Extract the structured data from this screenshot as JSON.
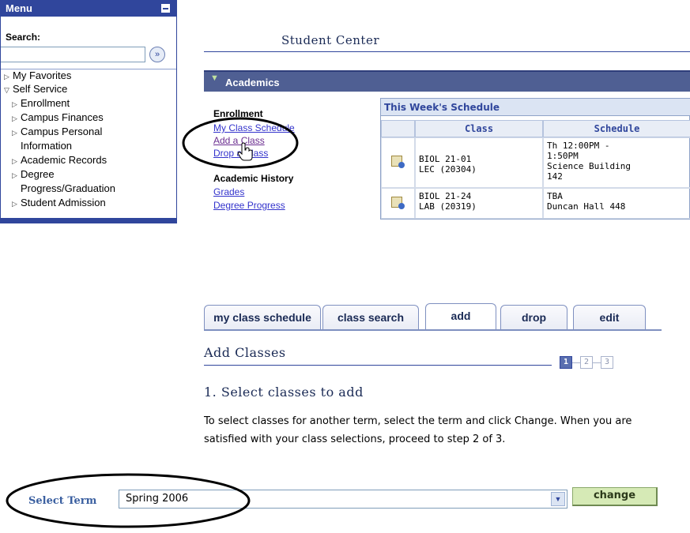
{
  "menu": {
    "title": "Menu",
    "search_label": "Search:",
    "search_value": "",
    "go_glyph": "»",
    "items": [
      {
        "label": "My Favorites",
        "state": "collapsed"
      },
      {
        "label": "Self Service",
        "state": "expanded"
      },
      {
        "label": "Enrollment",
        "state": "collapsed"
      },
      {
        "label": "Campus Finances",
        "state": "collapsed"
      },
      {
        "label": "Campus Personal",
        "state": "collapsed"
      },
      {
        "label": "Information",
        "state": "continuation"
      },
      {
        "label": "Academic Records",
        "state": "collapsed"
      },
      {
        "label": "Degree",
        "state": "collapsed"
      },
      {
        "label": "Progress/Graduation",
        "state": "continuation"
      },
      {
        "label": "Student Admission",
        "state": "collapsed"
      }
    ]
  },
  "student_center": {
    "title": "Student Center",
    "section": "Academics",
    "enrollment": {
      "heading": "Enrollment",
      "links": [
        "My Class Schedule",
        "Add a Class",
        "Drop a Class"
      ]
    },
    "academic_history": {
      "heading": "Academic History",
      "links": [
        "Grades",
        "Degree Progress"
      ]
    },
    "schedule": {
      "title": "This Week's Schedule",
      "columns": [
        "Class",
        "Schedule"
      ],
      "rows": [
        {
          "class_line1": "BIOL 21-01",
          "class_line2": "LEC (20304)",
          "schedule_lines": [
            "Th 12:00PM -",
            "1:50PM",
            "Science Building",
            "142"
          ]
        },
        {
          "class_line1": "BIOL 21-24",
          "class_line2": "LAB (20319)",
          "schedule_lines": [
            "TBA",
            "Duncan Hall 448"
          ]
        }
      ]
    }
  },
  "tabs": [
    {
      "label": "my class schedule",
      "active": false
    },
    {
      "label": "class search",
      "active": false
    },
    {
      "label": "add",
      "active": true
    },
    {
      "label": "drop",
      "active": false
    },
    {
      "label": "edit",
      "active": false
    }
  ],
  "add_classes": {
    "title": "Add Classes",
    "steps": [
      "1",
      "2",
      "3"
    ],
    "current_step": 1,
    "step_title": "1. Select classes to add",
    "instructions": "To select classes for another term, select the term and click Change. When you are satisfied with your class selections, proceed to step 2 of 3.",
    "term_label": "Select Term",
    "term_value": "Spring 2006",
    "change_label": "change"
  },
  "colors": {
    "brand_blue": "#30469c",
    "section_bar": "#4f5f93",
    "change_button": "#d6eab6",
    "link": "#3333cc"
  },
  "icons": [
    "collapse-icon",
    "go-icon",
    "triangle-right-icon",
    "triangle-down-icon",
    "calendar-icon",
    "hand-cursor-icon",
    "dropdown-arrow-icon"
  ]
}
